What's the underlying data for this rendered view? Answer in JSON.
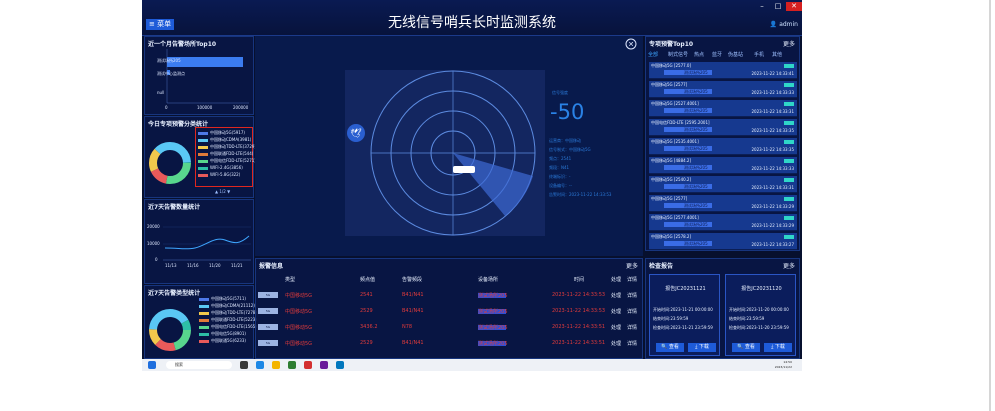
{
  "window": {
    "title": "无线信号哨兵长时监测系统",
    "menu_label": "菜单",
    "user": "admin"
  },
  "left_panels": {
    "top10_month": {
      "title": "近一个月告警场所Top10",
      "labels": [
        "测试场所205",
        "测试中心监测点",
        "null"
      ],
      "x_ticks": [
        "0",
        "100000",
        "200000"
      ]
    },
    "today_category": {
      "title": "今日专项预警分类统计",
      "legend": [
        "中国移动5G(5917)",
        "中国移动CDMA(3981)",
        "中国移动TDD-LTE(3729)",
        "中国联通FDD-LTE(544)",
        "中国电信FDD-LTE(5271)",
        "WIFI-2.4G(3856)",
        "WIFI-5.8G(322)"
      ],
      "legend_colors": [
        "#4e79e8",
        "#5ac8f5",
        "#f2c94c",
        "#e07b39",
        "#58d68d",
        "#2dbfa6",
        "#e85a5a"
      ],
      "pager": "1/2"
    },
    "week_trend": {
      "title": "近7天告警数量统计",
      "y_ticks": [
        "20000",
        "10000",
        "0"
      ],
      "x_ticks": [
        "11/13",
        "11/16",
        "11/20",
        "11/21"
      ]
    },
    "week_types": {
      "title": "近7天告警类型统计",
      "legend": [
        "中国移动5G(5711)",
        "中国移动CDMA(21112)",
        "中国移动TDD-LTE(7278)",
        "中国联通FDD-LTE(5223)",
        "中国电信FDD-LTE(1565)",
        "中国电信5G(8901)",
        "中国联通5G(6233)"
      ],
      "legend_colors": [
        "#4e79e8",
        "#5ac8f5",
        "#f2c94c",
        "#e07b39",
        "#58d68d",
        "#2dbfa6",
        "#e85a5a"
      ]
    }
  },
  "radar": {
    "value": "-50",
    "value_label": "信号强度",
    "info": [
      "运营商：中国移动",
      "信号制式：中国移动5G",
      "频点：2541",
      "频段：N41",
      "终端标识：-",
      "设备编号：--",
      "告警时间：2023-11-22 14:33:53"
    ]
  },
  "alarm_table": {
    "title": "报警信息",
    "more": "更多",
    "headers": [
      "类型",
      "频点值",
      "告警频段",
      "设备场所",
      "时间",
      "处理",
      "详情"
    ],
    "rows": [
      {
        "type": "中国移动5G",
        "freq": "2541",
        "band": "B41/N41",
        "site": "测试场所205",
        "time": "2023-11-22 14:33:53",
        "action": "处理",
        "detail": "详情"
      },
      {
        "type": "中国移动5G",
        "freq": "2529",
        "band": "B41/N41",
        "site": "测试场所205",
        "time": "2023-11-22 14:33:53",
        "action": "处理",
        "detail": "详情"
      },
      {
        "type": "中国移动5G",
        "freq": "3436.2",
        "band": "N78",
        "site": "测试场所205",
        "time": "2023-11-22 14:33:51",
        "action": "处理",
        "detail": "详情"
      },
      {
        "type": "中国移动5G",
        "freq": "2529",
        "band": "B41/N41",
        "site": "测试场所205",
        "time": "2023-11-22 14:33:51",
        "action": "处理",
        "detail": "详情"
      }
    ]
  },
  "right_list": {
    "title": "专项预警Top10",
    "more": "更多",
    "tabs": [
      "全部",
      "制式信号",
      "热点",
      "蓝牙",
      "伪基站",
      "手机",
      "其他"
    ],
    "items": [
      {
        "name": "中国移动5G [2577.0]",
        "tag": "测试场所205",
        "time": "2023-11-22 14:33:41"
      },
      {
        "name": "中国移动5G [2577]",
        "tag": "测试场所205",
        "time": "2023-11-22 14:33:33"
      },
      {
        "name": "中国移动5G [2527.4001]",
        "tag": "测试场所205",
        "time": "2023-11-22 14:33:31"
      },
      {
        "name": "中国电信FDD-LTE [2595.2001]",
        "tag": "测试场所205",
        "time": "2023-11-22 14:33:35"
      },
      {
        "name": "中国移动5G [2535.4001]",
        "tag": "测试场所205",
        "time": "2023-11-22 14:33:35"
      },
      {
        "name": "中国移动5G [4884.2]",
        "tag": "测试场所205",
        "time": "2023-11-22 14:33:33"
      },
      {
        "name": "中国移动5G [2540.2]",
        "tag": "测试场所205",
        "time": "2023-11-22 14:33:31"
      },
      {
        "name": "中国移动5G [2577]",
        "tag": "测试场所205",
        "time": "2023-11-22 14:33:29"
      },
      {
        "name": "中国移动5G [2577.4001]",
        "tag": "测试场所205",
        "time": "2023-11-22 14:33:29"
      },
      {
        "name": "中国移动5G [2578.2]",
        "tag": "测试场所205",
        "time": "2023-11-22 14:33:27"
      }
    ]
  },
  "reports": {
    "title": "检查报告",
    "more": "更多",
    "cards": [
      {
        "name": "报告JC20231121",
        "start": "开始时间:2023-11-21 00:00:00",
        "end": "结束时间:23:59:59",
        "check": "检查时间:2023-11-21 23:59:59",
        "view": "查看",
        "download": "下载"
      },
      {
        "name": "报告JC20231120",
        "start": "开始时间:2023-11-20 00:00:00",
        "end": "结束时间:23:59:59",
        "check": "检查时间:2023-11-20 23:59:59",
        "view": "查看",
        "download": "下载"
      }
    ]
  },
  "taskbar": {
    "search_placeholder": "搜索",
    "time": "14:50",
    "date": "2023/11/22"
  }
}
